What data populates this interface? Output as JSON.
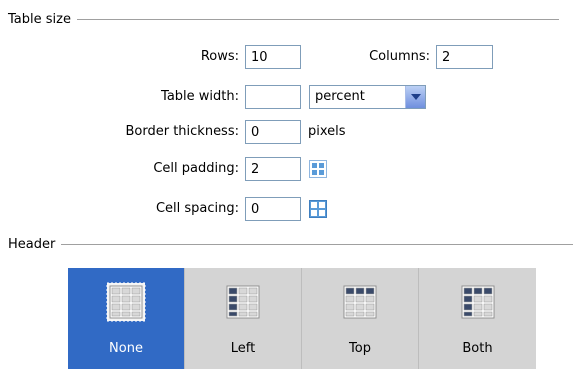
{
  "table_size": {
    "title": "Table size",
    "rows_label": "Rows:",
    "rows_value": "10",
    "columns_label": "Columns:",
    "columns_value": "2",
    "table_width_label": "Table width:",
    "table_width_value": "",
    "table_width_unit": "percent",
    "border_label": "Border thickness:",
    "border_value": "0",
    "border_unit": "pixels",
    "padding_label": "Cell padding:",
    "padding_value": "2",
    "spacing_label": "Cell spacing:",
    "spacing_value": "0"
  },
  "header": {
    "title": "Header",
    "selected": "None",
    "options": [
      {
        "label": "None",
        "icon": "table-header-none-icon"
      },
      {
        "label": "Left",
        "icon": "table-header-left-icon"
      },
      {
        "label": "Top",
        "icon": "table-header-top-icon"
      },
      {
        "label": "Both",
        "icon": "table-header-both-icon"
      }
    ]
  },
  "colors": {
    "selected_tile": "#316ac5",
    "tile": "#d4d4d4",
    "field_border": "#7f9db9",
    "header_cell": "#3a4a6a"
  }
}
